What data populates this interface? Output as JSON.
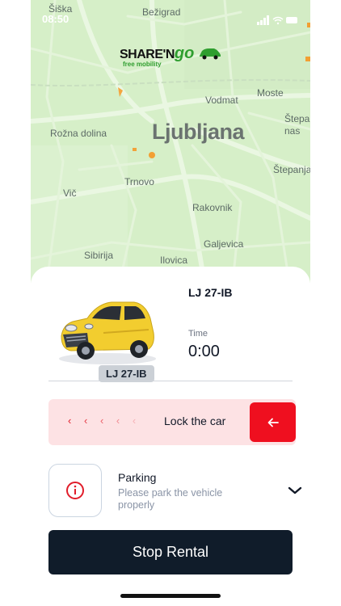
{
  "status_bar": {
    "time": "08:50"
  },
  "brand": {
    "name_part": "SHARE'N",
    "name_go": "go",
    "tagline": "free mobility"
  },
  "map": {
    "city": "Ljubljana",
    "labels": {
      "siska": "Šiška",
      "bezigrad": "Bežigrad",
      "vodmat": "Vodmat",
      "moste": "Moste",
      "stepa": "Štepa",
      "nas": "nas",
      "rozna_dolina": "Rožna dolina",
      "stepanja": "Štepanja",
      "trnovo": "Trnovo",
      "vic": "Vič",
      "rakovnik": "Rakovnik",
      "galjevica": "Galjevica",
      "sibirija": "Sibirija",
      "ilovica": "Ilovica"
    }
  },
  "vehicle": {
    "plate_badge": "LJ 27-IB",
    "plate_title": "LJ 27-IB",
    "body_color": "#f2cd2f"
  },
  "rental": {
    "time_label": "Time",
    "time_value": "0:00"
  },
  "lock": {
    "label": "Lock the car",
    "chevrons": [
      "‹",
      "‹",
      "‹",
      "‹",
      "‹"
    ]
  },
  "parking": {
    "title": "Parking",
    "description": "Please park the vehicle properly"
  },
  "actions": {
    "stop_label": "Stop Rental"
  },
  "colors": {
    "accent_red": "#ef0f1f",
    "map_green": "#d6efc8",
    "dark_button": "#101c2a"
  }
}
